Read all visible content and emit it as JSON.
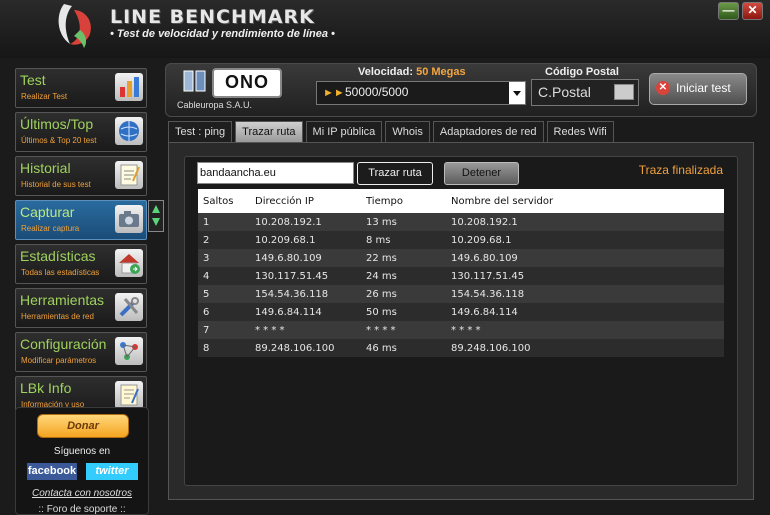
{
  "app": {
    "title": "LINE BENCHMARK",
    "subtitle": "• Test de velocidad y rendimiento de línea •"
  },
  "window": {
    "minimize": "—",
    "close": "✕"
  },
  "sidebar": {
    "items": [
      {
        "label": "Test",
        "sub": "Realizar Test",
        "icon": "chart-icon"
      },
      {
        "label": "Últimos/Top",
        "sub": "Últimos & Top 20 test",
        "icon": "globe-icon"
      },
      {
        "label": "Historial",
        "sub": "Historial de sus test",
        "icon": "notepad-icon"
      },
      {
        "label": "Capturar",
        "sub": "Realizar captura",
        "icon": "camera-icon"
      },
      {
        "label": "Estadísticas",
        "sub": "Todas las estadísticas",
        "icon": "house-icon"
      },
      {
        "label": "Herramientas",
        "sub": "Herramientas de red",
        "icon": "tools-icon"
      },
      {
        "label": "Configuración",
        "sub": "Modificar parámetros",
        "icon": "network-icon"
      },
      {
        "label": "LBk Info",
        "sub": "Información y uso",
        "icon": "info-icon"
      }
    ],
    "active_index": 3
  },
  "donate": {
    "button": "Donar",
    "follow": "Síguenos en",
    "facebook": "facebook",
    "twitter": "twitter",
    "contact": "Contacta con nosotros",
    "forum": ":: Foro de soporte ::"
  },
  "topbar": {
    "isp_logo": "ONO",
    "isp_name": "Cableuropa S.A.U.",
    "velocidad_label": "Velocidad:",
    "velocidad_value": "50 Megas",
    "speed_selected": "50000/5000",
    "cp_label": "Código Postal",
    "cp_value": "C.Postal",
    "start_button": "Iniciar test"
  },
  "tabs": [
    {
      "label": "Test : ping",
      "active": false
    },
    {
      "label": "Trazar ruta",
      "active": true
    },
    {
      "label": "Mi IP pública",
      "active": false
    },
    {
      "label": "Whois",
      "active": false
    },
    {
      "label": "Adaptadores de red",
      "active": false
    },
    {
      "label": "Redes Wifi",
      "active": false
    }
  ],
  "trace": {
    "host": "bandaancha.eu",
    "trace_button": "Trazar ruta",
    "stop_button": "Detener",
    "status": "Traza finalizada",
    "columns": [
      "Saltos",
      "Dirección IP",
      "Tiempo",
      "Nombre del servidor"
    ],
    "rows": [
      [
        "1",
        "10.208.192.1",
        "13 ms",
        "10.208.192.1"
      ],
      [
        "2",
        "10.209.68.1",
        "8 ms",
        "10.209.68.1"
      ],
      [
        "3",
        "149.6.80.109",
        "22 ms",
        "149.6.80.109"
      ],
      [
        "4",
        "130.117.51.45",
        "24 ms",
        "130.117.51.45"
      ],
      [
        "5",
        "154.54.36.118",
        "26 ms",
        "154.54.36.118"
      ],
      [
        "6",
        "149.6.84.114",
        "50 ms",
        "149.6.84.114"
      ],
      [
        "7",
        "* * * *",
        "* * * *",
        "* * * *"
      ],
      [
        "8",
        "89.248.106.100",
        "46 ms",
        "89.248.106.100"
      ]
    ]
  }
}
